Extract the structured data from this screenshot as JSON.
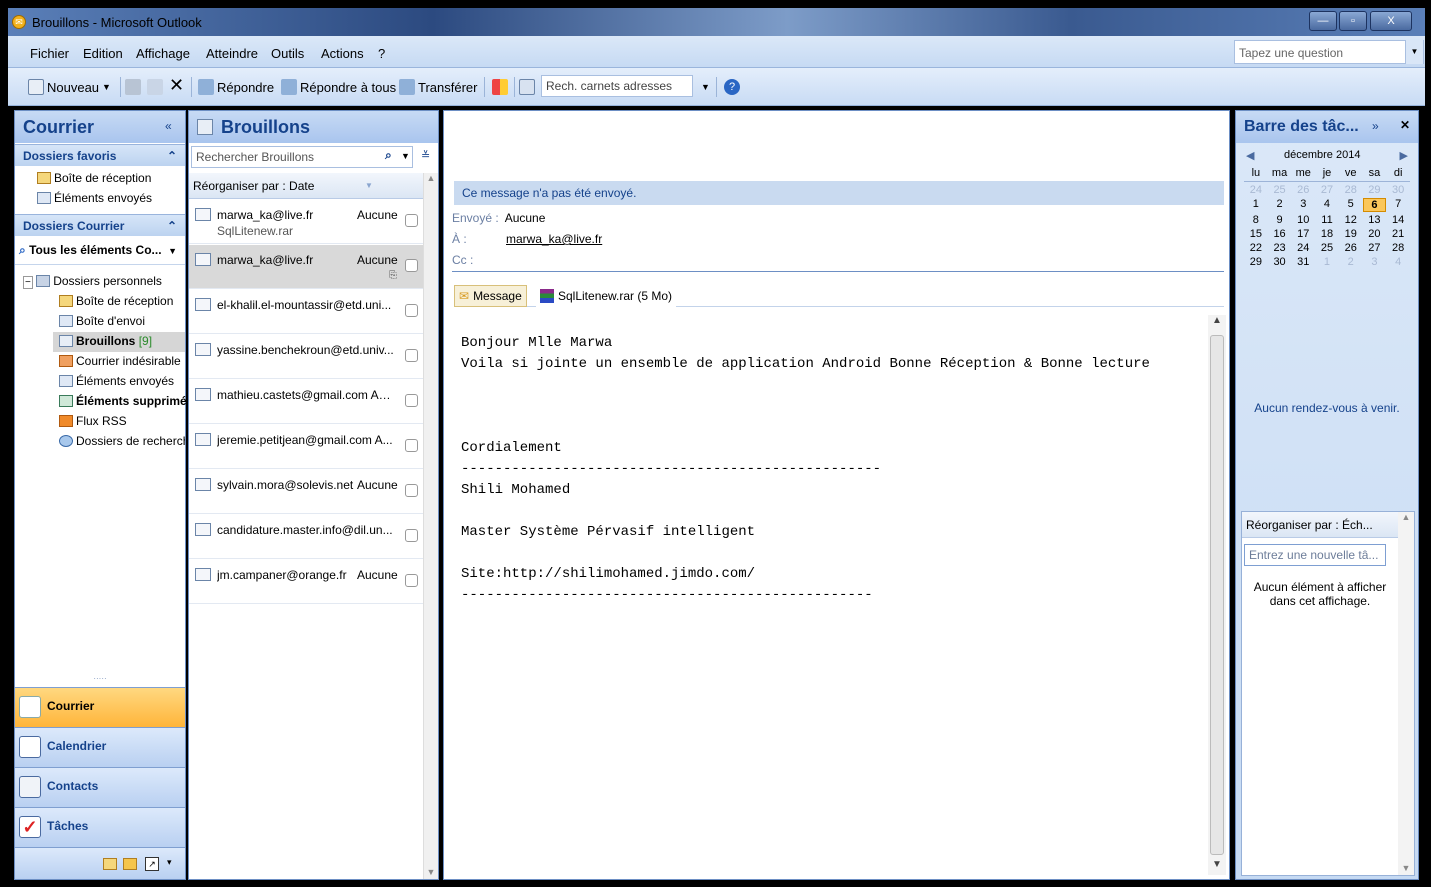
{
  "window": {
    "title": "Brouillons - Microsoft Outlook"
  },
  "menu": {
    "items": [
      "Fichier",
      "Edition",
      "Affichage",
      "Atteindre",
      "Outils",
      "Actions",
      "?"
    ],
    "help_placeholder": "Tapez une question"
  },
  "toolbar": {
    "new": "Nouveau",
    "reply": "Répondre",
    "reply_all": "Répondre à tous",
    "forward": "Transférer",
    "address_search": "Rech. carnets adresses"
  },
  "nav": {
    "header": "Courrier",
    "favorites_header": "Dossiers favoris",
    "favorites": [
      "Boîte de réception",
      "Éléments envoyés"
    ],
    "mail_folders_header": "Dossiers Courrier",
    "all_items": "Tous les éléments Co...",
    "root": "Dossiers personnels",
    "folders": [
      {
        "label": "Boîte de réception",
        "count": ""
      },
      {
        "label": "Boîte d'envoi",
        "count": ""
      },
      {
        "label": "Brouillons",
        "count": "[9]"
      },
      {
        "label": "Courrier indésirable",
        "count": ""
      },
      {
        "label": "Éléments envoyés",
        "count": ""
      },
      {
        "label": "Éléments supprimés",
        "count": ""
      },
      {
        "label": "Flux RSS",
        "count": ""
      },
      {
        "label": "Dossiers de recherche",
        "count": ""
      }
    ],
    "buttons": [
      "Courrier",
      "Calendrier",
      "Contacts",
      "Tâches"
    ]
  },
  "list": {
    "header": "Brouillons",
    "search_placeholder": "Rechercher Brouillons",
    "arrange_by": "Réorganiser par : Date",
    "messages": [
      {
        "from": "marwa_ka@live.fr",
        "date": "Aucune",
        "subject": "SqlLitenew.rar"
      },
      {
        "from": "marwa_ka@live.fr",
        "date": "Aucune",
        "subject": ""
      },
      {
        "from": "el-khalil.el-mountassir@etd.uni...",
        "date": "",
        "subject": ""
      },
      {
        "from": "yassine.benchekroun@etd.univ...",
        "date": "",
        "subject": ""
      },
      {
        "from": "mathieu.castets@gmail.com Auc...",
        "date": "",
        "subject": ""
      },
      {
        "from": "jeremie.petitjean@gmail.com  A...",
        "date": "",
        "subject": ""
      },
      {
        "from": "sylvain.mora@solevis.net",
        "date": "Aucune",
        "subject": ""
      },
      {
        "from": "candidature.master.info@dil.un...",
        "date": "",
        "subject": ""
      },
      {
        "from": "jm.campaner@orange.fr",
        "date": "Aucune",
        "subject": ""
      }
    ]
  },
  "reading": {
    "notice": "Ce message n'a pas été envoyé.",
    "sent_label": "Envoyé :",
    "sent_value": "Aucune",
    "to_label": "À :",
    "to_value": "marwa_ka@live.fr",
    "cc_label": "Cc :",
    "tab_message": "Message",
    "attachment": "SqlLitenew.rar (5 Mo)",
    "body": "Bonjour Mlle Marwa\nVoila si jointe un ensemble de application Android Bonne Réception & Bonne lecture\n\n\n\nCordialement\n--------------------------------------------------\nShili Mohamed\n\nMaster Système Pérvasif intelligent\n\nSite:http://shilimohamed.jimdo.com/\n-------------------------------------------------"
  },
  "todo": {
    "header": "Barre des tâc...",
    "month": "décembre 2014",
    "weekdays": [
      "lu",
      "ma",
      "me",
      "je",
      "ve",
      "sa",
      "di"
    ],
    "weeks": [
      [
        "24",
        "25",
        "26",
        "27",
        "28",
        "29",
        "30"
      ],
      [
        "1",
        "2",
        "3",
        "4",
        "5",
        "6",
        "7"
      ],
      [
        "8",
        "9",
        "10",
        "11",
        "12",
        "13",
        "14"
      ],
      [
        "15",
        "16",
        "17",
        "18",
        "19",
        "20",
        "21"
      ],
      [
        "22",
        "23",
        "24",
        "25",
        "26",
        "27",
        "28"
      ],
      [
        "29",
        "30",
        "31",
        "1",
        "2",
        "3",
        "4"
      ]
    ],
    "today": "6",
    "no_appointments": "Aucun rendez-vous à venir.",
    "task_arrange": "Réorganiser par : Éch...",
    "new_task_placeholder": "Entrez une nouvelle tâ...",
    "no_items": "Aucun élément à afficher dans cet affichage."
  },
  "colors": {
    "accent": "#15428b",
    "active_nav": "#ffc55a",
    "pane_border": "#6d8fc4"
  }
}
